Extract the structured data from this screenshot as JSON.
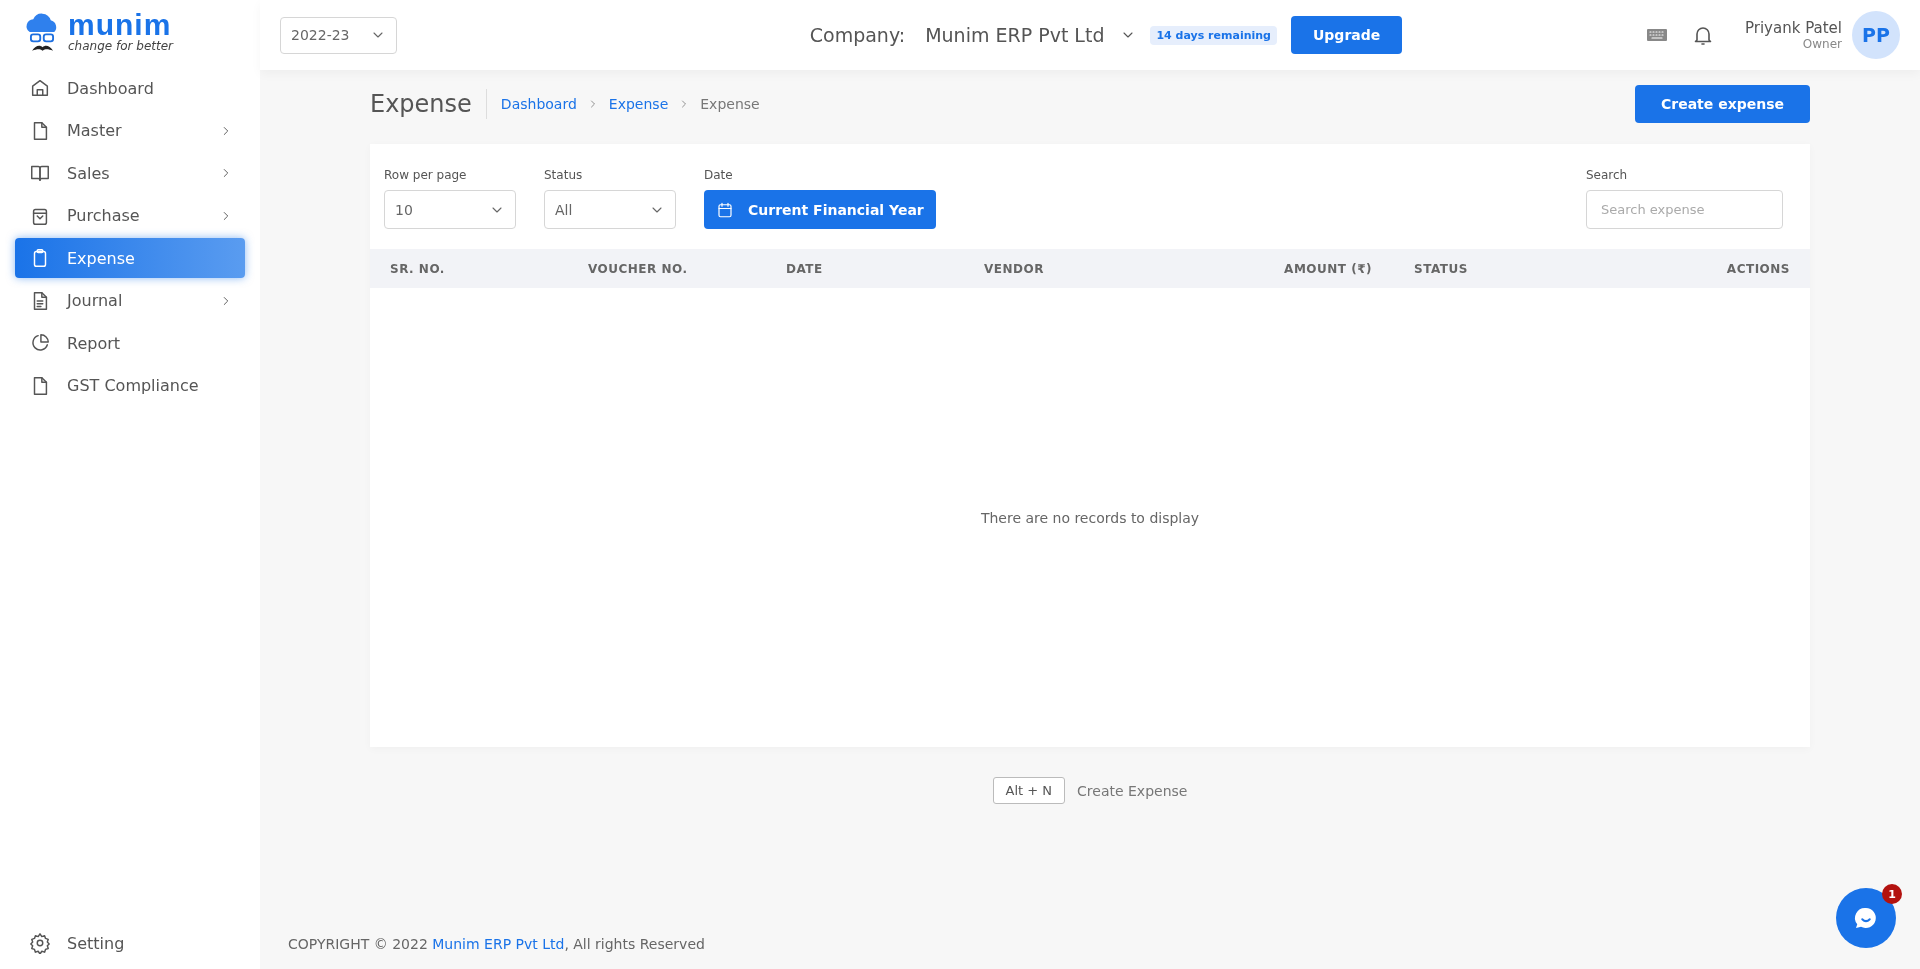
{
  "logo": {
    "name": "munim",
    "tagline": "change for better"
  },
  "sidebar": {
    "items": [
      {
        "label": "Dashboard",
        "submenu": false,
        "selected": false
      },
      {
        "label": "Master",
        "submenu": true,
        "selected": false
      },
      {
        "label": "Sales",
        "submenu": true,
        "selected": false
      },
      {
        "label": "Purchase",
        "submenu": true,
        "selected": false
      },
      {
        "label": "Expense",
        "submenu": false,
        "selected": true
      },
      {
        "label": "Journal",
        "submenu": true,
        "selected": false
      },
      {
        "label": "Report",
        "submenu": false,
        "selected": false
      },
      {
        "label": "GST Compliance",
        "submenu": false,
        "selected": false
      }
    ],
    "setting": {
      "label": "Setting"
    }
  },
  "header": {
    "year": "2022-23",
    "company_label": "Company:",
    "company": "Munim ERP Pvt Ltd",
    "trial_badge": "14 days remaining",
    "upgrade": "Upgrade",
    "user": {
      "name": "Priyank Patel",
      "role": "Owner",
      "initials": "PP"
    }
  },
  "page": {
    "title": "Expense",
    "breadcrumbs": [
      {
        "label": "Dashboard",
        "current": false
      },
      {
        "label": "Expense",
        "current": false
      },
      {
        "label": "Expense",
        "current": true
      }
    ],
    "create_button": "Create expense"
  },
  "filters": {
    "rows": {
      "label": "Row per page",
      "value": "10"
    },
    "status": {
      "label": "Status",
      "value": "All"
    },
    "date": {
      "label": "Date",
      "value": "Current Financial Year"
    },
    "search": {
      "label": "Search",
      "placeholder": "Search expense"
    }
  },
  "table": {
    "columns": [
      {
        "label": "SR. NO."
      },
      {
        "label": "VOUCHER NO."
      },
      {
        "label": "DATE"
      },
      {
        "label": "VENDOR"
      },
      {
        "label": "AMOUNT (₹)"
      },
      {
        "label": "STATUS"
      },
      {
        "label": "ACTIONS"
      }
    ],
    "empty_message": "There are no records to display"
  },
  "shortcut": {
    "key": "Alt + N",
    "label": "Create Expense"
  },
  "footer": {
    "prefix": "COPYRIGHT © 2022 ",
    "link": "Munim ERP Pvt Ltd",
    "suffix": ", All rights Reserved"
  },
  "chat": {
    "badge": "1"
  }
}
